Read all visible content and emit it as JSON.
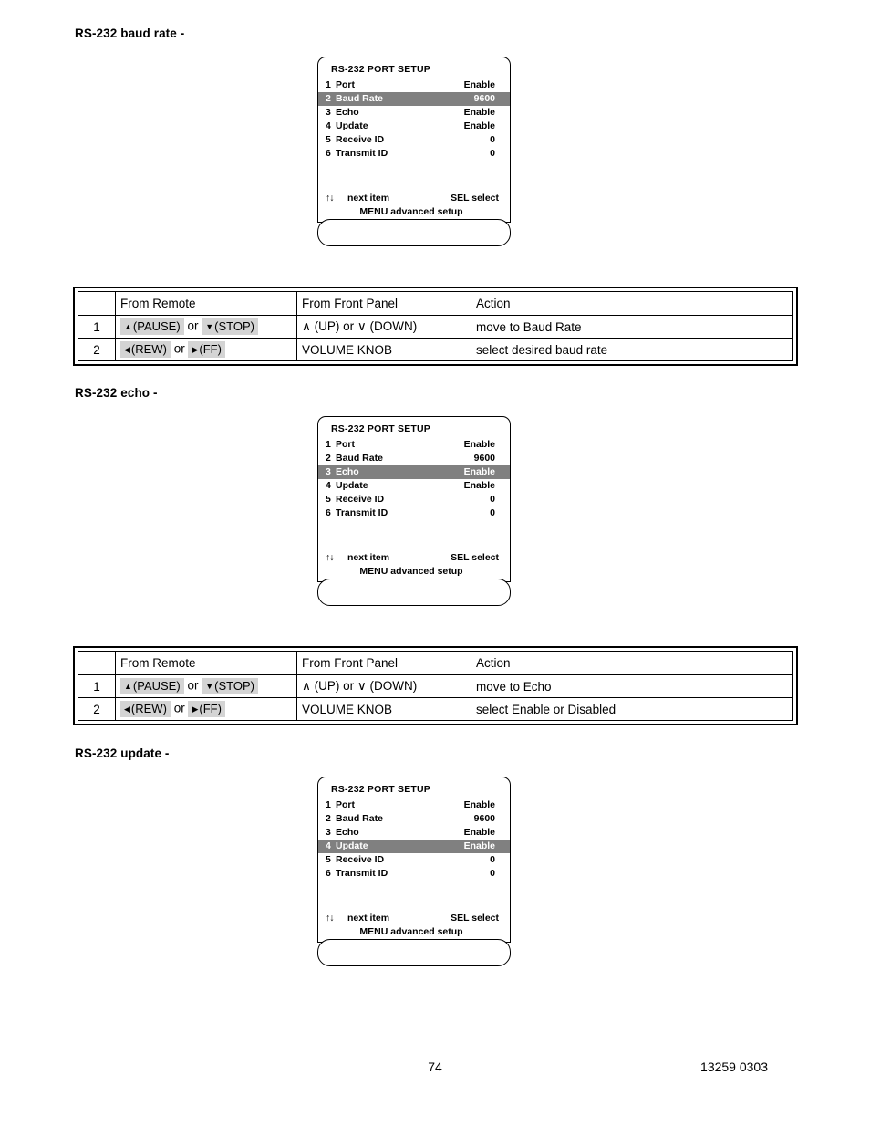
{
  "sections": [
    {
      "heading": "RS-232 baud rate -",
      "lcd": {
        "title": "RS-232 PORT SETUP",
        "rows": [
          {
            "num": "1",
            "label": "Port",
            "value": "Enable",
            "selected": false
          },
          {
            "num": "2",
            "label": "Baud Rate",
            "value": "9600",
            "selected": true
          },
          {
            "num": "3",
            "label": "Echo",
            "value": "Enable",
            "selected": false
          },
          {
            "num": "4",
            "label": "Update",
            "value": "Enable",
            "selected": false
          },
          {
            "num": "5",
            "label": "Receive   ID",
            "value": "0",
            "selected": false
          },
          {
            "num": "6",
            "label": "Transmit ID",
            "value": "0",
            "selected": false
          }
        ],
        "footer": {
          "arrows": "↑↓",
          "next_item": "next item",
          "select": "SEL   select",
          "advanced": "MENU   advanced setup"
        }
      },
      "table": {
        "headers": {
          "index": "",
          "remote": "From Remote",
          "front_panel": "From Front Panel",
          "action": "Action"
        },
        "rows": [
          {
            "index": "1",
            "remote_keys": [
              "(PAUSE)",
              "(STOP)"
            ],
            "remote_sep": "or",
            "front_panel": "∧ (UP) or ∨ (DOWN)",
            "action": "move to Baud Rate"
          },
          {
            "index": "2",
            "remote_keys": [
              "(REW)",
              "(FF)"
            ],
            "remote_sep": "or",
            "front_panel": "VOLUME KNOB",
            "action": "select desired baud rate"
          }
        ]
      }
    },
    {
      "heading": "RS-232 echo -",
      "lcd": {
        "title": "RS-232 PORT SETUP",
        "rows": [
          {
            "num": "1",
            "label": "Port",
            "value": "Enable",
            "selected": false
          },
          {
            "num": "2",
            "label": "Baud Rate",
            "value": "9600",
            "selected": false
          },
          {
            "num": "3",
            "label": "Echo",
            "value": "Enable",
            "selected": true
          },
          {
            "num": "4",
            "label": "Update",
            "value": "Enable",
            "selected": false
          },
          {
            "num": "5",
            "label": "Receive   ID",
            "value": "0",
            "selected": false
          },
          {
            "num": "6",
            "label": "Transmit ID",
            "value": "0",
            "selected": false
          }
        ],
        "footer": {
          "arrows": "↑↓",
          "next_item": "next item",
          "select": "SEL   select",
          "advanced": "MENU   advanced setup"
        }
      },
      "table": {
        "headers": {
          "index": "",
          "remote": "From Remote",
          "front_panel": "From Front Panel",
          "action": "Action"
        },
        "rows": [
          {
            "index": "1",
            "remote_keys": [
              "(PAUSE)",
              "(STOP)"
            ],
            "remote_sep": "or",
            "front_panel": "∧ (UP) or ∨ (DOWN)",
            "action": "move to Echo"
          },
          {
            "index": "2",
            "remote_keys": [
              "(REW)",
              "(FF)"
            ],
            "remote_sep": "or",
            "front_panel": "VOLUME KNOB",
            "action": "select Enable or Disabled"
          }
        ]
      }
    },
    {
      "heading": "RS-232 update -",
      "lcd": {
        "title": "RS-232 PORT SETUP",
        "rows": [
          {
            "num": "1",
            "label": "Port",
            "value": "Enable",
            "selected": false
          },
          {
            "num": "2",
            "label": "Baud Rate",
            "value": "9600",
            "selected": false
          },
          {
            "num": "3",
            "label": "Echo",
            "value": "Enable",
            "selected": false
          },
          {
            "num": "4",
            "label": "Update",
            "value": "Enable",
            "selected": true
          },
          {
            "num": "5",
            "label": "Receive   ID",
            "value": "0",
            "selected": false
          },
          {
            "num": "6",
            "label": "Transmit ID",
            "value": "0",
            "selected": false
          }
        ],
        "footer": {
          "arrows": "↑↓",
          "next_item": "next item",
          "select": "SEL   select",
          "advanced": "MENU   advanced setup"
        }
      },
      "table": null
    }
  ],
  "footer": {
    "page_number": "74",
    "document_code": "13259 0303"
  }
}
